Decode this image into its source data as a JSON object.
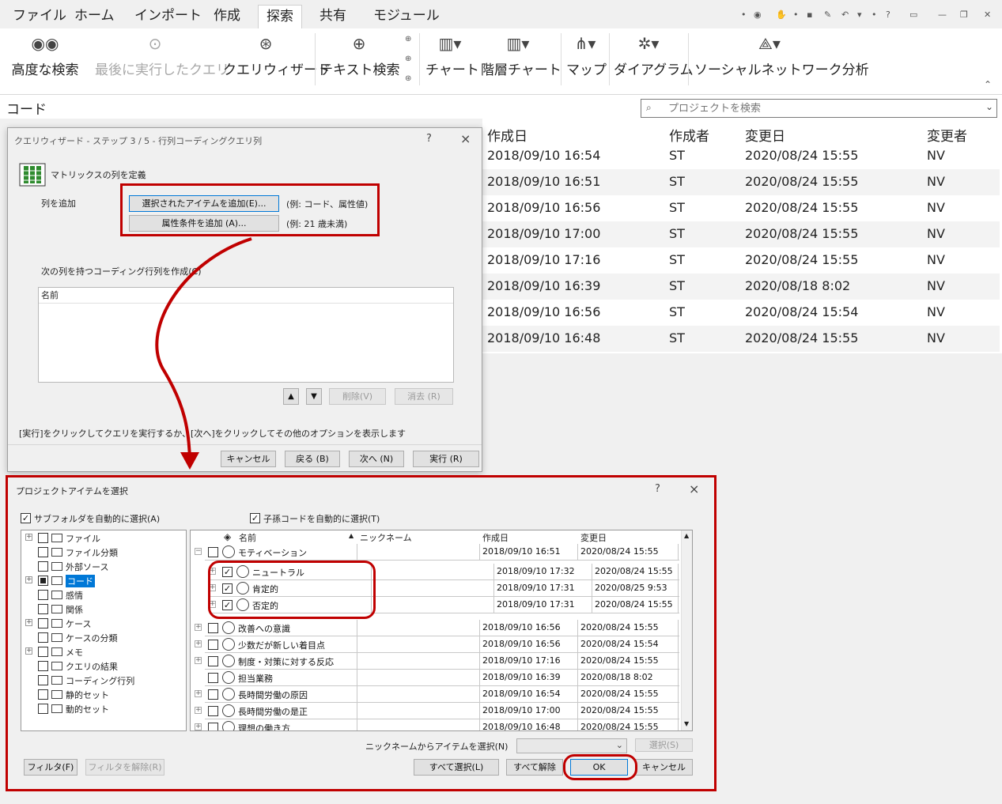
{
  "menu": {
    "tabs": [
      "ファイル",
      "ホーム",
      "インポート",
      "作成",
      "探索",
      "共有",
      "モジュール"
    ],
    "active_index": 4
  },
  "ribbon": {
    "advanced_search": "高度な検索",
    "last_query": "最後に実行したクエリ",
    "query_wizard": "クエリウィザード",
    "text_search": "テキスト検索",
    "chart": "チャート",
    "hierarchy_chart": "階層チャート",
    "map": "マップ",
    "diagram": "ダイアグラム",
    "social_network": "ソーシャルネットワーク分析"
  },
  "codes": {
    "title": "コード",
    "search_placeholder": "プロジェクトを検索"
  },
  "main_table": {
    "headers": [
      "作成日",
      "作成者",
      "変更日",
      "変更者"
    ],
    "rows": [
      [
        "2018/09/10 16:54",
        "ST",
        "2020/08/24 15:55",
        "NV"
      ],
      [
        "2018/09/10 16:51",
        "ST",
        "2020/08/24 15:55",
        "NV"
      ],
      [
        "2018/09/10 16:56",
        "ST",
        "2020/08/24 15:55",
        "NV"
      ],
      [
        "2018/09/10 17:00",
        "ST",
        "2020/08/24 15:55",
        "NV"
      ],
      [
        "2018/09/10 17:16",
        "ST",
        "2020/08/24 15:55",
        "NV"
      ],
      [
        "2018/09/10 16:39",
        "ST",
        "2020/08/18 8:02",
        "NV"
      ],
      [
        "2018/09/10 16:56",
        "ST",
        "2020/08/24 15:54",
        "NV"
      ],
      [
        "2018/09/10 16:48",
        "ST",
        "2020/08/24 15:55",
        "NV"
      ]
    ]
  },
  "wizard": {
    "title": "クエリウィザード - ステップ 3 / 5 - 行列コーディングクエリ列",
    "help": "?",
    "close": "×",
    "heading": "マトリックスの列を定義",
    "add_columns_label": "列を追加",
    "add_selected_btn": "選択されたアイテムを追加(E)...",
    "add_selected_hint": "(例: コード、属性値)",
    "add_attr_btn": "属性条件を追加 (A)...",
    "add_attr_hint": "(例: 21 歳未満)",
    "create_matrix_label": "次の列を持つコーディング行列を作成(C)",
    "list_header": "名前",
    "up": "▲",
    "down": "▼",
    "delete_btn": "削除(V)",
    "clear_btn": "消去 (R)",
    "instruction": "[実行]をクリックしてクエリを実行するか、[次へ]をクリックしてその他のオプションを表示します",
    "cancel_btn": "キャンセル",
    "back_btn": "戻る (B)",
    "next_btn": "次へ (N)",
    "run_btn": "実行 (R)"
  },
  "selector": {
    "title": "プロジェクトアイテムを選択",
    "help": "?",
    "close": "×",
    "auto_subfolder": "サブフォルダを自動的に選択(A)",
    "auto_child": "子孫コードを自動的に選択(T)",
    "tree": [
      {
        "label": "ファイル",
        "expand": true,
        "state": "unchecked",
        "indent": 0
      },
      {
        "label": "ファイル分類",
        "expand": false,
        "state": "unchecked",
        "indent": 0
      },
      {
        "label": "外部ソース",
        "expand": false,
        "state": "unchecked",
        "indent": 0
      },
      {
        "label": "コード",
        "expand": true,
        "state": "partial",
        "indent": 0,
        "selected": true
      },
      {
        "label": "感情",
        "expand": false,
        "state": "unchecked",
        "indent": 0
      },
      {
        "label": "関係",
        "expand": false,
        "state": "unchecked",
        "indent": 0
      },
      {
        "label": "ケース",
        "expand": true,
        "state": "unchecked",
        "indent": 0
      },
      {
        "label": "ケースの分類",
        "expand": false,
        "state": "unchecked",
        "indent": 0
      },
      {
        "label": "メモ",
        "expand": true,
        "state": "unchecked",
        "indent": 0
      },
      {
        "label": "クエリの結果",
        "expand": false,
        "state": "unchecked",
        "indent": 0
      },
      {
        "label": "コーディング行列",
        "expand": false,
        "state": "unchecked",
        "indent": 0
      },
      {
        "label": "静的セット",
        "expand": false,
        "state": "unchecked",
        "indent": 0
      },
      {
        "label": "動的セット",
        "expand": false,
        "state": "unchecked",
        "indent": 0
      }
    ],
    "grid_headers": {
      "name": "名前",
      "nickname": "ニックネーム",
      "created": "作成日",
      "modified": "変更日"
    },
    "parent_row": {
      "name": "モティベーション",
      "created": "2018/09/10 16:51",
      "modified": "2020/08/24 15:55"
    },
    "child_rows": [
      {
        "name": "ニュートラル",
        "created": "2018/09/10 17:32",
        "modified": "2020/08/24 15:55",
        "checked": true
      },
      {
        "name": "肯定的",
        "created": "2018/09/10 17:31",
        "modified": "2020/08/25 9:53",
        "checked": true
      },
      {
        "name": "否定的",
        "created": "2018/09/10 17:31",
        "modified": "2020/08/24 15:55",
        "checked": true
      }
    ],
    "rows": [
      {
        "name": "改善への意識",
        "created": "2018/09/10 16:56",
        "modified": "2020/08/24 15:55",
        "expand": true
      },
      {
        "name": "少数だが新しい着目点",
        "created": "2018/09/10 16:56",
        "modified": "2020/08/24 15:54",
        "expand": true
      },
      {
        "name": "制度・対策に対する反応",
        "created": "2018/09/10 17:16",
        "modified": "2020/08/24 15:55",
        "expand": true
      },
      {
        "name": "担当業務",
        "created": "2018/09/10 16:39",
        "modified": "2020/08/18 8:02",
        "expand": false
      },
      {
        "name": "長時間労働の原因",
        "created": "2018/09/10 16:54",
        "modified": "2020/08/24 15:55",
        "expand": true
      },
      {
        "name": "長時間労働の是正",
        "created": "2018/09/10 17:00",
        "modified": "2020/08/24 15:55",
        "expand": true
      },
      {
        "name": "理想の働き方",
        "created": "2018/09/10 16:48",
        "modified": "2020/08/24 15:55",
        "expand": true
      }
    ],
    "nickname_select_label": "ニックネームからアイテムを選択(N)",
    "select_btn": "選択(S)",
    "filter_btn": "フィルタ(F)",
    "clear_filter_btn": "フィルタを解除(R)",
    "select_all_btn": "すべて選択(L)",
    "deselect_all_btn": "すべて解除",
    "ok_btn": "OK",
    "cancel_btn": "キャンセル"
  },
  "colors": {
    "accent": "#0078d7",
    "highlight_red": "#c00000"
  }
}
